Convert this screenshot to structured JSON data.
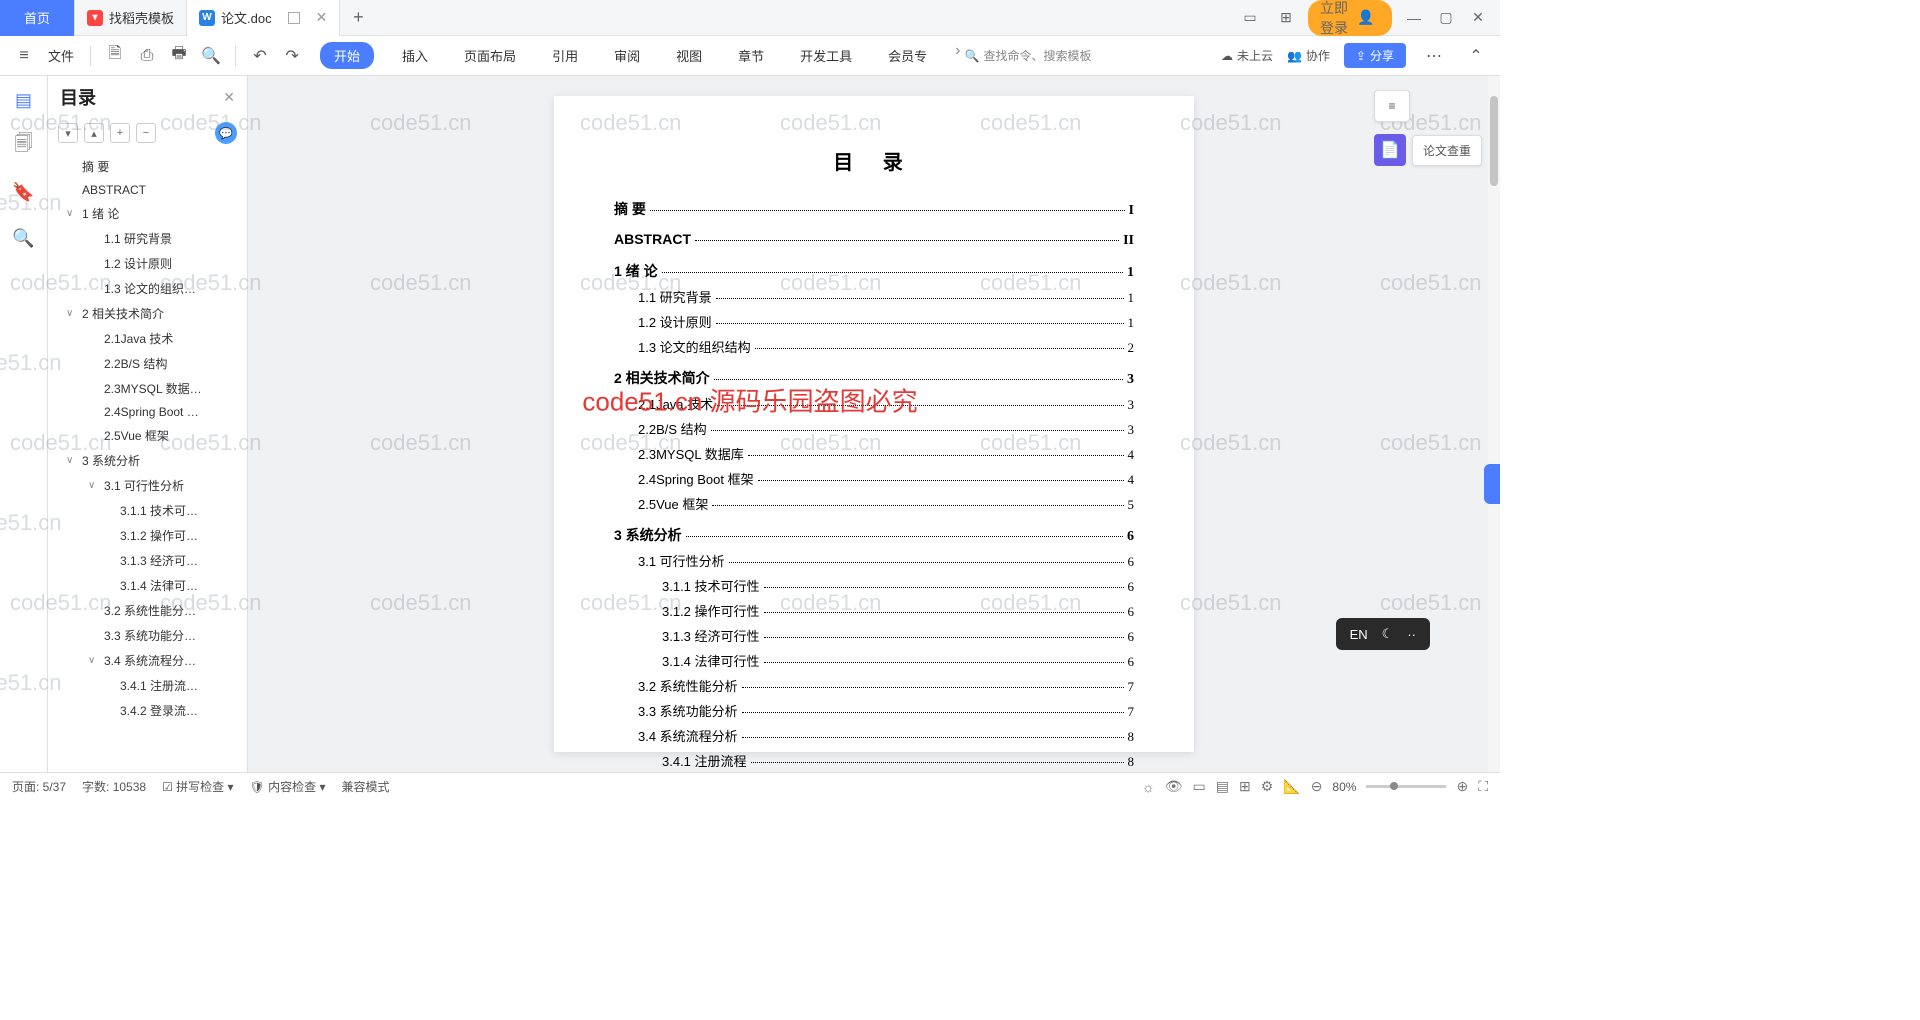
{
  "titlebar": {
    "home_tab": "首页",
    "tab1": "找稻壳模板",
    "tab2": "论文.doc",
    "login": "立即登录"
  },
  "toolbar": {
    "file": "文件",
    "menus": [
      "开始",
      "插入",
      "页面布局",
      "引用",
      "审阅",
      "视图",
      "章节",
      "开发工具",
      "会员专"
    ],
    "search_placeholder": "查找命令、搜索模板",
    "not_uploaded": "未上云",
    "collab": "协作",
    "share": "分享"
  },
  "outline": {
    "title": "目录",
    "items": [
      {
        "lvl": 0,
        "chev": "",
        "txt": "摘 要"
      },
      {
        "lvl": 0,
        "chev": "",
        "txt": "ABSTRACT"
      },
      {
        "lvl": 1,
        "chev": "∨",
        "txt": "1 绪 论"
      },
      {
        "lvl": 2,
        "chev": "",
        "txt": "1.1 研究背景"
      },
      {
        "lvl": 2,
        "chev": "",
        "txt": "1.2 设计原则"
      },
      {
        "lvl": 2,
        "chev": "",
        "txt": "1.3 论文的组织…"
      },
      {
        "lvl": 1,
        "chev": "∨",
        "txt": "2 相关技术简介"
      },
      {
        "lvl": 2,
        "chev": "",
        "txt": "2.1Java 技术"
      },
      {
        "lvl": 2,
        "chev": "",
        "txt": "2.2B/S 结构"
      },
      {
        "lvl": 2,
        "chev": "",
        "txt": "2.3MYSQL 数据…"
      },
      {
        "lvl": 2,
        "chev": "",
        "txt": "2.4Spring Boot …"
      },
      {
        "lvl": 2,
        "chev": "",
        "txt": "2.5Vue 框架"
      },
      {
        "lvl": 1,
        "chev": "∨",
        "txt": "3 系统分析"
      },
      {
        "lvl": 2,
        "chev": "∨",
        "txt": "3.1 可行性分析"
      },
      {
        "lvl": 3,
        "chev": "",
        "txt": "3.1.1 技术可…"
      },
      {
        "lvl": 3,
        "chev": "",
        "txt": "3.1.2 操作可…"
      },
      {
        "lvl": 3,
        "chev": "",
        "txt": "3.1.3 经济可…"
      },
      {
        "lvl": 3,
        "chev": "",
        "txt": "3.1.4 法律可…"
      },
      {
        "lvl": 2,
        "chev": "",
        "txt": "3.2 系统性能分…"
      },
      {
        "lvl": 2,
        "chev": "",
        "txt": "3.3 系统功能分…"
      },
      {
        "lvl": 2,
        "chev": "∨",
        "txt": "3.4 系统流程分…"
      },
      {
        "lvl": 3,
        "chev": "",
        "txt": "3.4.1 注册流…"
      },
      {
        "lvl": 3,
        "chev": "",
        "txt": "3.4.2 登录流…"
      }
    ]
  },
  "document": {
    "toc_heading": "目 录",
    "lines": [
      {
        "bold": true,
        "ind": 0,
        "label": "摘 要",
        "page": "I"
      },
      {
        "bold": true,
        "ind": 0,
        "label": "ABSTRACT",
        "page": "II"
      },
      {
        "bold": true,
        "ind": 0,
        "label": "1 绪 论",
        "page": "1"
      },
      {
        "bold": false,
        "ind": 1,
        "label": "1.1 研究背景",
        "page": "1"
      },
      {
        "bold": false,
        "ind": 1,
        "label": "1.2 设计原则",
        "page": "1"
      },
      {
        "bold": false,
        "ind": 1,
        "label": "1.3 论文的组织结构",
        "page": "2"
      },
      {
        "bold": true,
        "ind": 0,
        "label": "2 相关技术简介",
        "page": "3"
      },
      {
        "bold": false,
        "ind": 1,
        "label": "2.1Java 技术",
        "page": "3"
      },
      {
        "bold": false,
        "ind": 1,
        "label": "2.2B/S 结构",
        "page": "3"
      },
      {
        "bold": false,
        "ind": 1,
        "label": "2.3MYSQL 数据库",
        "page": "4"
      },
      {
        "bold": false,
        "ind": 1,
        "label": "2.4Spring Boot 框架",
        "page": "4"
      },
      {
        "bold": false,
        "ind": 1,
        "label": "2.5Vue 框架",
        "page": "5"
      },
      {
        "bold": true,
        "ind": 0,
        "label": "3 系统分析",
        "page": "6"
      },
      {
        "bold": false,
        "ind": 1,
        "label": "3.1 可行性分析",
        "page": "6"
      },
      {
        "bold": false,
        "ind": 2,
        "label": "3.1.1 技术可行性",
        "page": "6"
      },
      {
        "bold": false,
        "ind": 2,
        "label": "3.1.2 操作可行性",
        "page": "6"
      },
      {
        "bold": false,
        "ind": 2,
        "label": "3.1.3 经济可行性",
        "page": "6"
      },
      {
        "bold": false,
        "ind": 2,
        "label": "3.1.4 法律可行性",
        "page": "6"
      },
      {
        "bold": false,
        "ind": 1,
        "label": "3.2 系统性能分析",
        "page": "7"
      },
      {
        "bold": false,
        "ind": 1,
        "label": "3.3 系统功能分析",
        "page": "7"
      },
      {
        "bold": false,
        "ind": 1,
        "label": "3.4 系统流程分析",
        "page": "8"
      },
      {
        "bold": false,
        "ind": 2,
        "label": "3.4.1 注册流程",
        "page": "8"
      }
    ]
  },
  "right_panel": {
    "plagiarism": "论文查重"
  },
  "watermark": {
    "center": "code51.cn 源码乐园盗图必究",
    "bg": "code51.cn"
  },
  "ime": {
    "lang": "EN"
  },
  "statusbar": {
    "page": "页面: 5/37",
    "words": "字数: 10538",
    "spellcheck": "拼写检查",
    "content_check": "内容检查",
    "compat": "兼容模式",
    "zoom": "80%"
  }
}
